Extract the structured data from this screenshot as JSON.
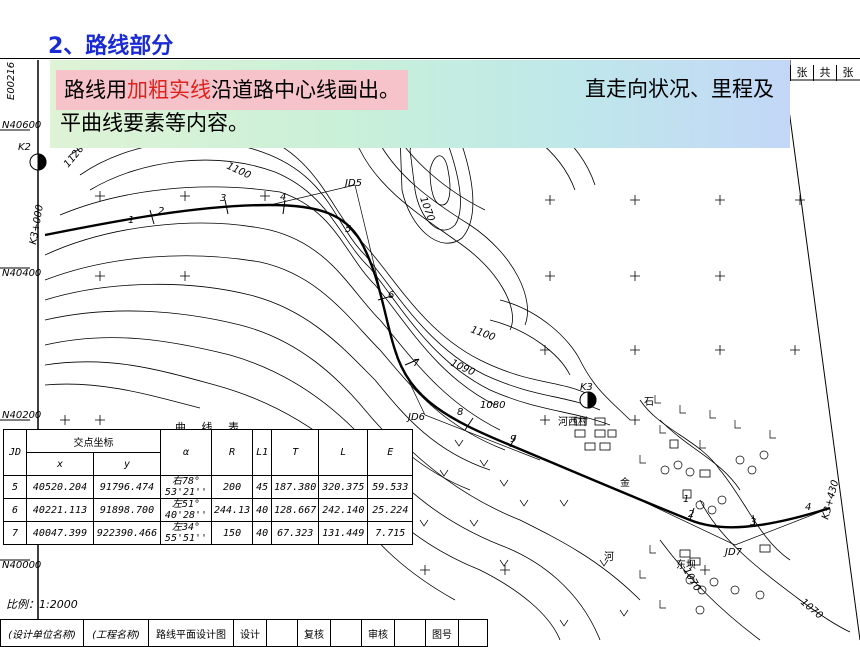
{
  "slide_title": "2、路线部分",
  "callout": {
    "head_prefix": "路线用",
    "head_highlight": "加粗实线",
    "head_suffix": "沿道路中心线画出。",
    "body_tail": "直走向状况、里程及",
    "body_line2": "平曲线要素等内容。"
  },
  "sheet_info": [
    "张",
    "共",
    "张"
  ],
  "map_labels": {
    "grid_n1": "N40600",
    "grid_n2": "N40400",
    "grid_n3": "N40200",
    "grid_n4": "N40000",
    "e_top": "E00216",
    "k2": "K2",
    "k3": "K3",
    "k_start": "K3+000",
    "k_end": "K3+430",
    "jd5": "JD5",
    "jd6": "JD6",
    "jd7": "JD7",
    "c1100a": "1100",
    "c1100b": "1100",
    "c1070a": "1070",
    "c1070b": "1070",
    "c1070c": "1070",
    "c1090": "1090",
    "c1080": "1080",
    "c1120": "1120",
    "village": "河西村",
    "village2": "东坝",
    "river1": "河",
    "river2": "石",
    "river3": "金",
    "st": [
      "1",
      "2",
      "3",
      "4",
      "5",
      "6",
      "7",
      "8",
      "9",
      "1",
      "2",
      "3",
      "4"
    ]
  },
  "curve_table": {
    "title": "曲 线 表",
    "headers": {
      "jd": "JD",
      "coord": "交点坐标",
      "x": "x",
      "y": "y",
      "alpha": "α",
      "r": "R",
      "l1": "L1",
      "t": "T",
      "l": "L",
      "e": "E"
    },
    "rows": [
      {
        "jd": "5",
        "x": "40520.204",
        "y": "91796.474",
        "alpha_dir": "右78°",
        "alpha_val": "53'21''",
        "r": "200",
        "l1": "45",
        "t": "187.380",
        "l": "320.375",
        "e": "59.533"
      },
      {
        "jd": "6",
        "x": "40221.113",
        "y": "91898.700",
        "alpha_dir": "左51°",
        "alpha_val": "40'28''",
        "r": "244.13",
        "l1": "40",
        "t": "128.667",
        "l": "242.140",
        "e": "25.224"
      },
      {
        "jd": "7",
        "x": "40047.399",
        "y": "922390.466",
        "alpha_dir": "左34°",
        "alpha_val": "55'51''",
        "r": "150",
        "l1": "40",
        "t": "67.323",
        "l": "131.449",
        "e": "7.715"
      }
    ]
  },
  "scale_text": "比例：1:2000",
  "title_block": [
    "(设计单位名称)",
    "(工程名称)",
    "路线平面设计图",
    "设计",
    "",
    "复核",
    "",
    "审核",
    "",
    "图号",
    ""
  ]
}
